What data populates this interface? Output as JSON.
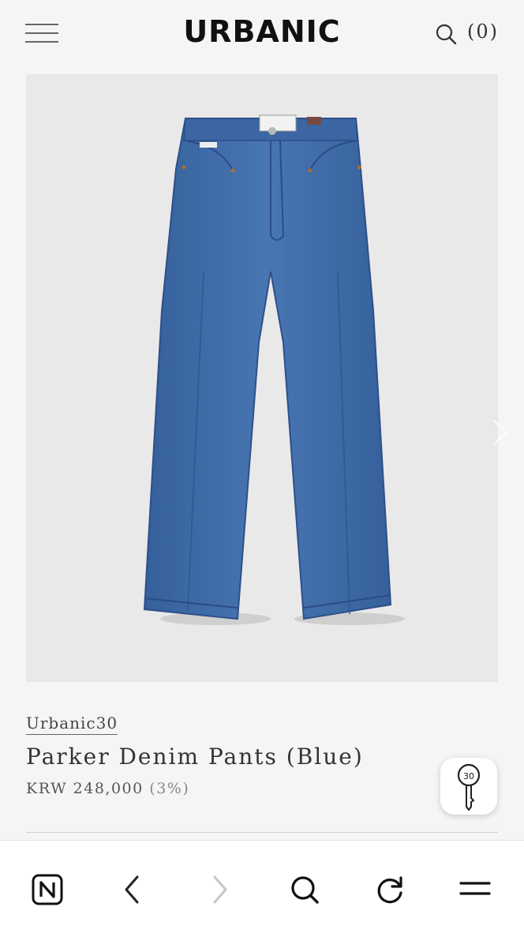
{
  "header": {
    "logo": "URBANIC",
    "cart_count": "(0)",
    "icons": {
      "menu": "hamburger-icon",
      "search": "search-icon"
    }
  },
  "product": {
    "brand": "Urbanic30",
    "name": "Parker Denim Pants (Blue)",
    "price": "KRW 248,000",
    "rate": "(3%)",
    "image_alt": "blue straight-leg denim pants",
    "denim_color": "#3f6aa6"
  },
  "floating": {
    "icon": "key-30-icon"
  },
  "toolbar": {
    "icons": [
      "naver-home-icon",
      "back-icon",
      "forward-icon",
      "search-icon",
      "refresh-icon",
      "menu-icon"
    ]
  }
}
